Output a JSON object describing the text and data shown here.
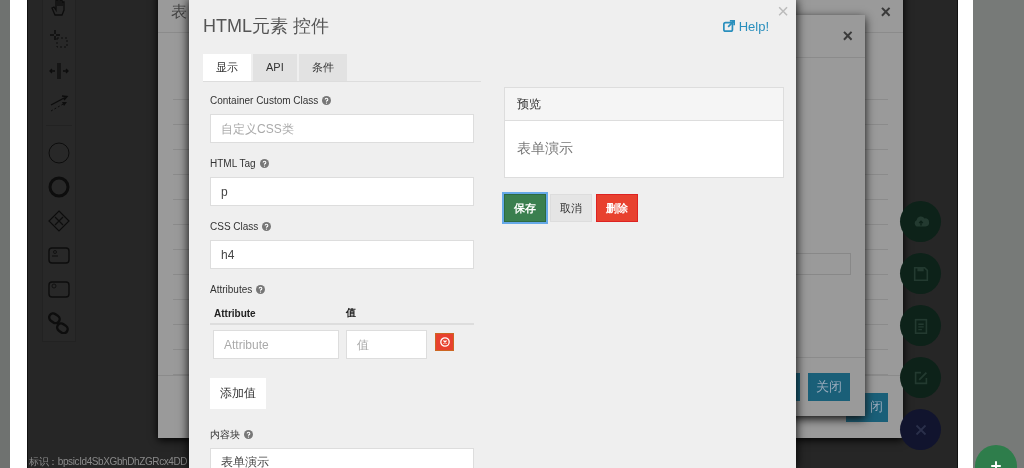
{
  "back_dialog": {
    "title": "表",
    "close": "×",
    "footer_button": "闭"
  },
  "middle_dialog": {
    "close": "×",
    "buttons": [
      {
        "kind": "primary"
      },
      {
        "label": "关闭",
        "kind": "primary"
      }
    ]
  },
  "footer_text": "标识：bpsicId4SbXGbhDhZGRcx4DD",
  "dialog": {
    "title": "HTML元素 控件",
    "help": "Help!",
    "close": "×",
    "tabs": [
      {
        "label": "显示",
        "selected": true
      },
      {
        "label": "API",
        "selected": false
      },
      {
        "label": "条件",
        "selected": false
      }
    ],
    "fields": [
      {
        "label": "Container Custom Class",
        "placeholder": "自定义CSS类"
      },
      {
        "label": "HTML Tag",
        "value": "p"
      },
      {
        "label": "CSS Class",
        "value": "h4"
      }
    ],
    "attributes": {
      "label": "Attributes",
      "columns": [
        "Attribute",
        "值"
      ],
      "rows": [
        {
          "attribute_placeholder": "Attribute",
          "value_placeholder": "值"
        }
      ]
    },
    "add_button": "添加值",
    "content": {
      "label": "内容块",
      "value": "表单演示"
    },
    "preview": {
      "title": "预览",
      "text": "表单演示"
    },
    "actions": [
      {
        "label": "保存",
        "kind": "primary",
        "focused": true
      },
      {
        "label": "取消",
        "kind": "default",
        "focused": false
      },
      {
        "label": "删除",
        "kind": "danger",
        "focused": false
      }
    ]
  }
}
